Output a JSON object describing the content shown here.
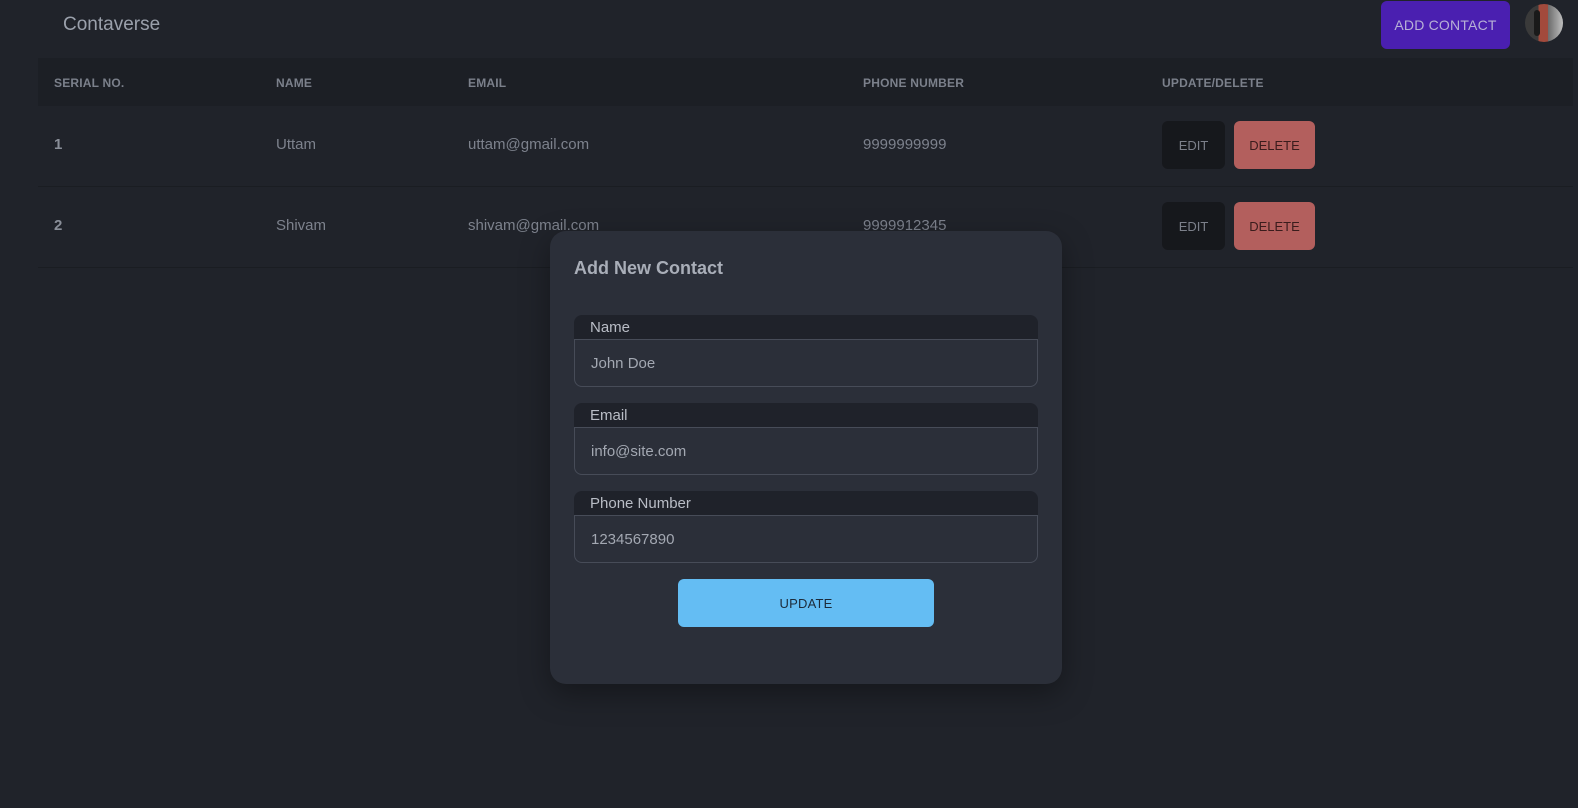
{
  "app": {
    "brand": "Contaverse",
    "add_contact_label": "ADD CONTACT"
  },
  "table": {
    "headers": {
      "serial": "SERIAL NO.",
      "name": "NAME",
      "email": "EMAIL",
      "phone": "PHONE NUMBER",
      "actions": "UPDATE/DELETE"
    },
    "rows": [
      {
        "serial": "1",
        "name": "Uttam",
        "email": "uttam@gmail.com",
        "phone": "9999999999",
        "edit_label": "EDIT",
        "delete_label": "DELETE"
      },
      {
        "serial": "2",
        "name": "Shivam",
        "email": "shivam@gmail.com",
        "phone": "9999912345",
        "edit_label": "EDIT",
        "delete_label": "DELETE"
      }
    ]
  },
  "modal": {
    "title": "Add New Contact",
    "fields": {
      "name": {
        "label": "Name",
        "placeholder": "John Doe"
      },
      "email": {
        "label": "Email",
        "placeholder": "info@site.com"
      },
      "phone": {
        "label": "Phone Number",
        "placeholder": "1234567890"
      }
    },
    "submit_label": "UPDATE"
  },
  "colors": {
    "background": "#20232a",
    "accent_primary": "#4a1fb0",
    "danger": "#b35f5d",
    "submit": "#64bdf3"
  }
}
